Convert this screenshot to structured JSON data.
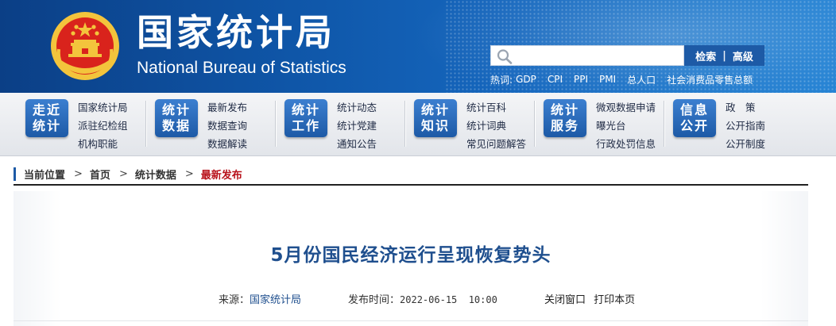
{
  "header": {
    "title_cn": "国家统计局",
    "title_en": "National Bureau of Statistics",
    "search": {
      "placeholder": "",
      "search_label": "检索",
      "separator": "|",
      "advanced_label": "高级"
    },
    "hot": {
      "label": "热词:",
      "items": [
        "GDP",
        "CPI",
        "PPI",
        "PMI",
        "总人口",
        "社会消费品零售总额"
      ]
    }
  },
  "nav": [
    {
      "badge": [
        "走近",
        "统计"
      ],
      "links": [
        "国家统计局",
        "派驻纪检组",
        "机构职能"
      ]
    },
    {
      "badge": [
        "统计",
        "数据"
      ],
      "links": [
        "最新发布",
        "数据查询",
        "数据解读"
      ]
    },
    {
      "badge": [
        "统计",
        "工作"
      ],
      "links": [
        "统计动态",
        "统计党建",
        "通知公告"
      ]
    },
    {
      "badge": [
        "统计",
        "知识"
      ],
      "links": [
        "统计百科",
        "统计词典",
        "常见问题解答"
      ]
    },
    {
      "badge": [
        "统计",
        "服务"
      ],
      "links": [
        "微观数据申请",
        "曝光台",
        "行政处罚信息"
      ]
    },
    {
      "badge": [
        "信息",
        "公开"
      ],
      "links": [
        "政　策",
        "公开指南",
        "公开制度"
      ]
    }
  ],
  "breadcrumb": {
    "label": "当前位置",
    "items": [
      "首页",
      "统计数据"
    ],
    "current": "最新发布",
    "arrow": ">"
  },
  "article": {
    "title": "5月份国民经济运行呈现恢复势头",
    "source_label": "来源：",
    "source": "国家统计局",
    "time_label": "发布时间：",
    "time": "2022-06-15  10:00",
    "close_label": "关闭窗口",
    "print_label": "打印本页"
  },
  "colors": {
    "header_blue": "#0f56a8",
    "badge_blue": "#1d5aa6",
    "title_blue": "#1f4f8e",
    "current_red": "#b8121b",
    "emblem_red": "#d9231c",
    "emblem_gold": "#f3c43c"
  }
}
